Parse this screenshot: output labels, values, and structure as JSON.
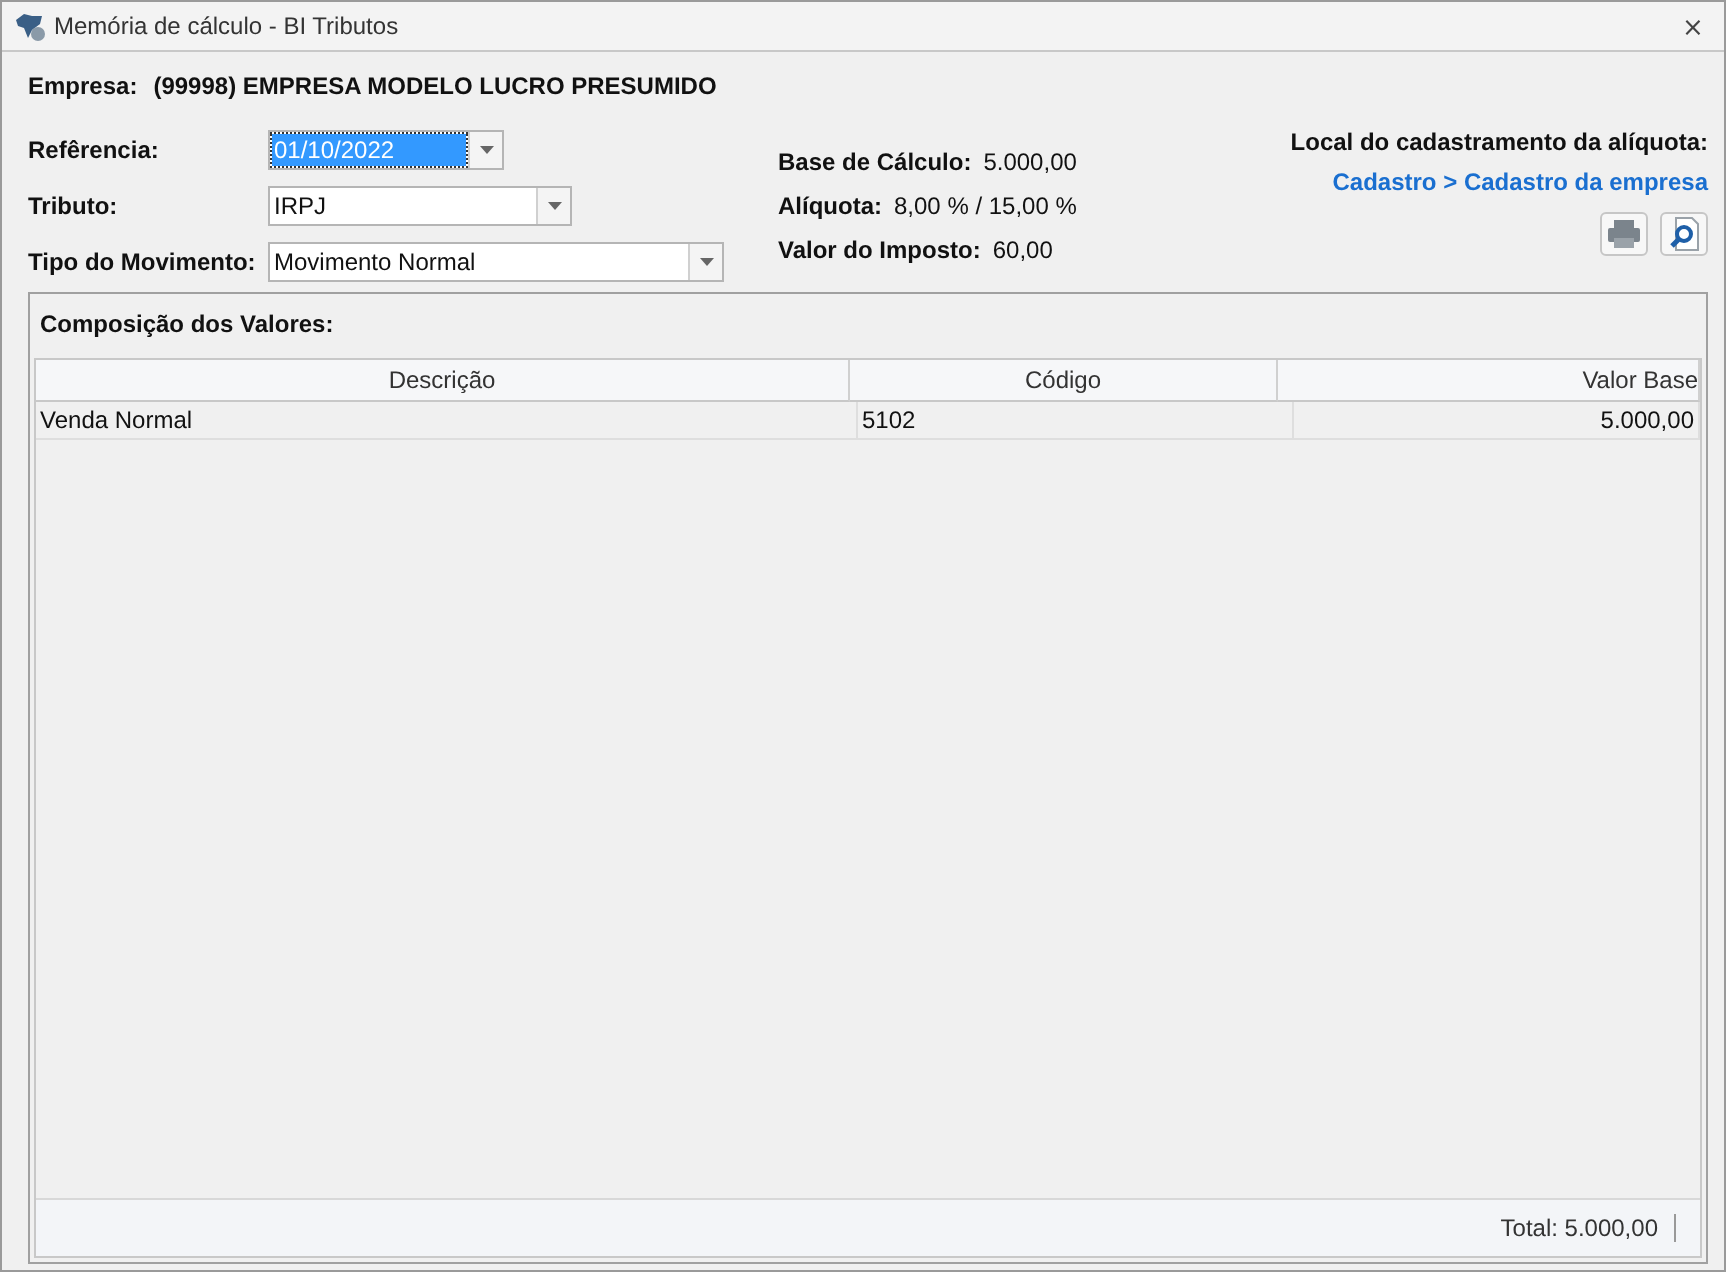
{
  "window": {
    "title": "Memória de cálculo - BI Tributos",
    "close": "⨯"
  },
  "empresa": {
    "label": "Empresa:",
    "value": "(99998) EMPRESA MODELO LUCRO PRESUMIDO"
  },
  "fields": [
    {
      "label": "Refêrencia:",
      "value": "01/10/2022",
      "focused": true,
      "kind": "short"
    },
    {
      "label": "Tributo:",
      "value": "IRPJ",
      "focused": false,
      "kind": "medium"
    },
    {
      "label": "Tipo do Movimento:",
      "value": "Movimento Normal",
      "focused": false,
      "kind": "long"
    }
  ],
  "summary": [
    {
      "label": "Base de Cálculo:",
      "value": "5.000,00"
    },
    {
      "label": "Alíquota:",
      "value": "8,00  % / 15,00  %"
    },
    {
      "label": "Valor do Imposto:",
      "value": "60,00"
    }
  ],
  "aliquota_local": {
    "label": "Local do cadastramento da alíquota:",
    "link": "Cadastro > Cadastro da empresa"
  },
  "panel": {
    "title": "Composição dos Valores:",
    "table": {
      "columns": [
        "Descrição",
        "Código",
        "Valor Base"
      ],
      "rows": [
        [
          "Venda Normal",
          "5102",
          "5.000,00"
        ]
      ]
    },
    "total": "Total: 5.000,00"
  }
}
